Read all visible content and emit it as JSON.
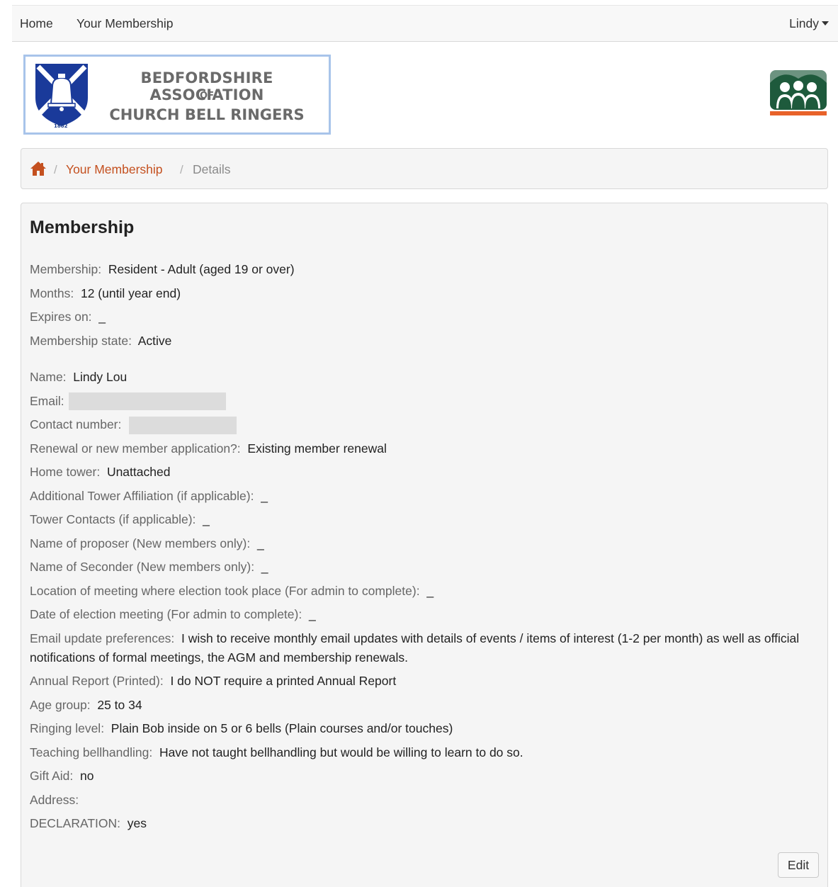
{
  "nav": {
    "home": "Home",
    "membership": "Your Membership",
    "user": "Lindy"
  },
  "logo": {
    "line1": "BEDFORDSHIRE ASSOCIATION",
    "line2": "OF",
    "line3": "CHURCH BELL RINGERS",
    "year": "1882",
    "shield_icon": "bell-shield-icon"
  },
  "members_icon": "members-group-icon",
  "breadcrumb": {
    "home_icon": "home-icon",
    "sep": "/",
    "membership": "Your Membership",
    "current": "Details"
  },
  "panel": {
    "title": "Membership",
    "fields_a": [
      {
        "label": "Membership:",
        "value": "Resident - Adult (aged 19 or over)"
      },
      {
        "label": "Months:",
        "value": "12 (until year end)"
      },
      {
        "label": "Expires on:",
        "value": "_"
      },
      {
        "label": "Membership state:",
        "value": "Active"
      }
    ],
    "fields_b": [
      {
        "label": "Name:",
        "value": "Lindy Lou"
      },
      {
        "label": "Email:",
        "value": ""
      },
      {
        "label": "Contact number:",
        "value": ""
      },
      {
        "label": "Renewal or new member application?:",
        "value": "Existing member renewal"
      },
      {
        "label": "Home tower:",
        "value": "Unattached"
      },
      {
        "label": "Additional Tower Affiliation (if applicable):",
        "value": "_"
      },
      {
        "label": "Tower Contacts (if applicable):",
        "value": "_"
      },
      {
        "label": "Name of proposer (New members only):",
        "value": "_"
      },
      {
        "label": "Name of Seconder (New members only):",
        "value": "_"
      },
      {
        "label": "Location of meeting where election took place (For admin to complete):",
        "value": "_"
      },
      {
        "label": "Date of election meeting (For admin to complete):",
        "value": "_"
      },
      {
        "label": "Email update preferences:",
        "value": "I wish to receive monthly email updates with details of events / items of interest (1-2 per month) as well as official notifications of formal meetings, the AGM and membership renewals."
      },
      {
        "label": "Annual Report (Printed):",
        "value": "I do NOT require a printed Annual Report"
      },
      {
        "label": "Age group:",
        "value": "25 to 34"
      },
      {
        "label": "Ringing level:",
        "value": "Plain Bob inside on 5 or 6 bells (Plain courses and/or touches)"
      },
      {
        "label": "Teaching bellhandling:",
        "value": "Have not taught bellhandling but would be willing to learn to do so."
      },
      {
        "label": "Gift Aid:",
        "value": "no"
      },
      {
        "label": "Address:",
        "value": ""
      },
      {
        "label": "DECLARATION:",
        "value": "yes"
      }
    ],
    "edit_label": "Edit"
  },
  "colors": {
    "link": "#c4501f",
    "logo_border": "#a8c4ea",
    "shield_blue": "#1a3a9a",
    "members_green": "#1e5a3c",
    "members_orange": "#e8622a"
  }
}
